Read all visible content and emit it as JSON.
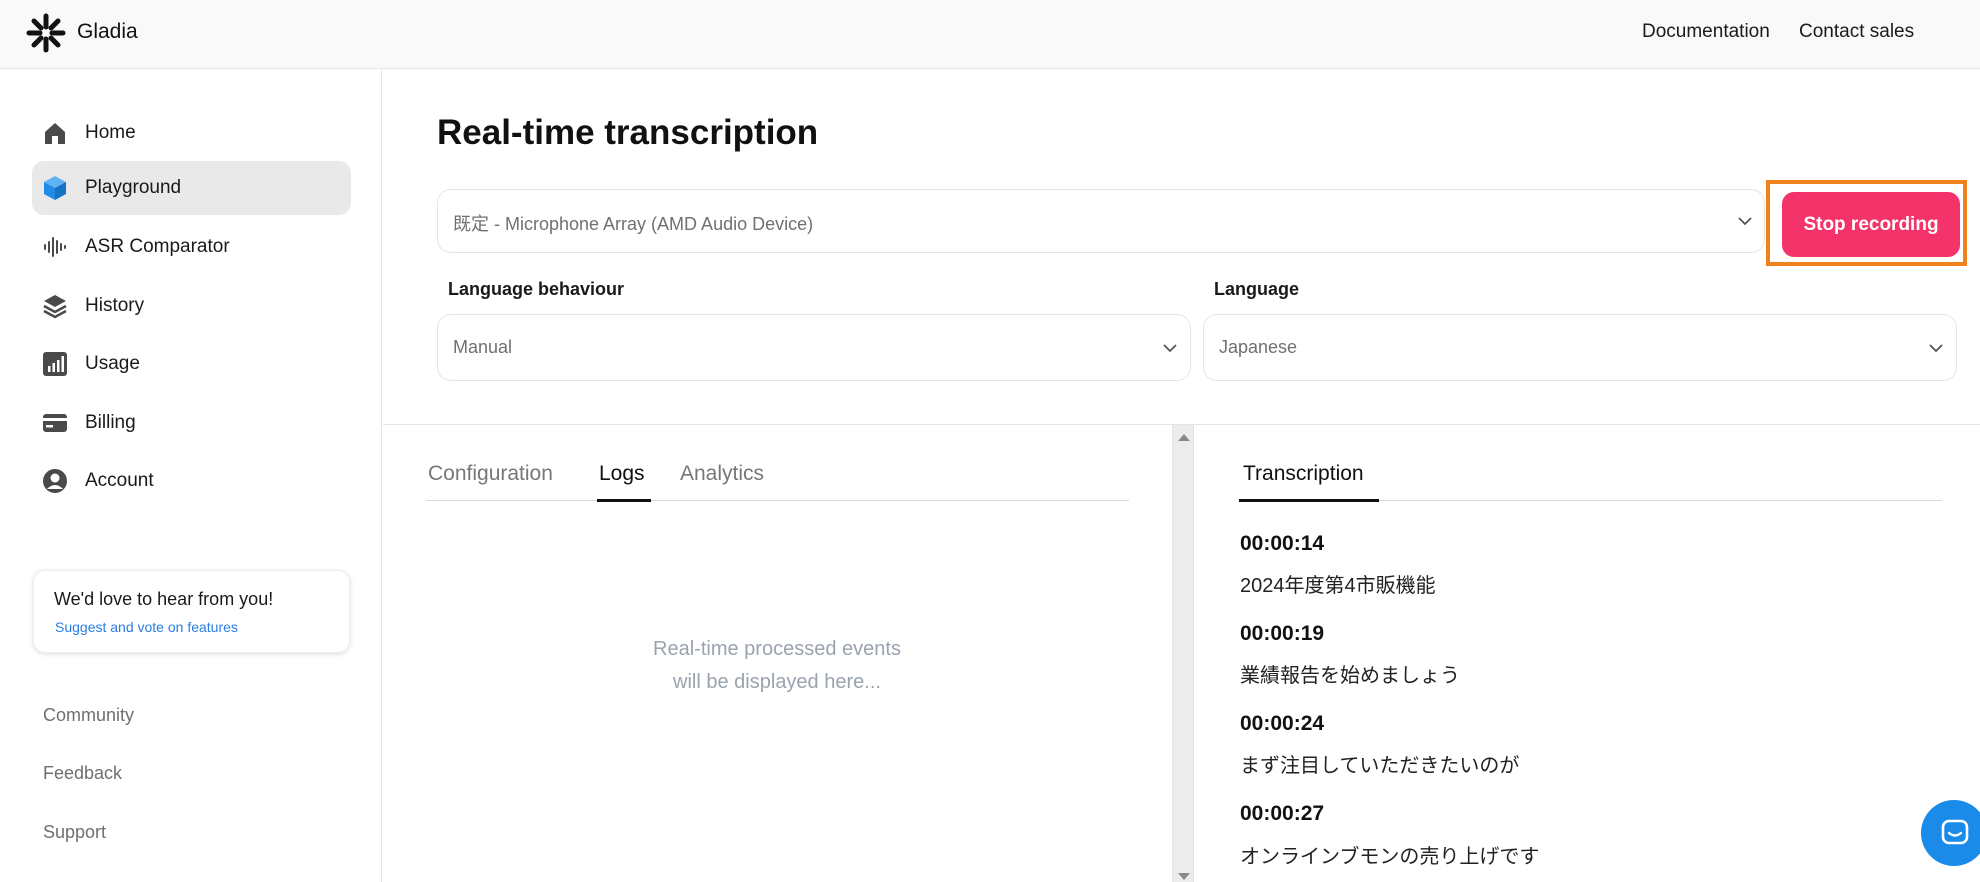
{
  "header": {
    "brand": "Gladia",
    "links": [
      "Documentation",
      "Contact sales"
    ]
  },
  "sidebar": {
    "items": [
      {
        "label": "Home",
        "icon": "home-icon"
      },
      {
        "label": "Playground",
        "icon": "cube-icon"
      },
      {
        "label": "ASR Comparator",
        "icon": "waveform-icon"
      },
      {
        "label": "History",
        "icon": "layers-icon"
      },
      {
        "label": "Usage",
        "icon": "bar-chart-icon"
      },
      {
        "label": "Billing",
        "icon": "credit-card-icon"
      },
      {
        "label": "Account",
        "icon": "user-circle-icon"
      }
    ],
    "active": "Playground",
    "feedback_card": {
      "title": "We'd love to hear from you!",
      "link": "Suggest and vote on features"
    },
    "footer_links": [
      "Community",
      "Feedback",
      "Support"
    ]
  },
  "main": {
    "title": "Real-time transcription",
    "device_select": "既定 - Microphone Array (AMD Audio Device)",
    "stop_button": "Stop recording",
    "language_behaviour": {
      "label": "Language behaviour",
      "value": "Manual"
    },
    "language": {
      "label": "Language",
      "value": "Japanese"
    }
  },
  "left_panel": {
    "tabs": [
      "Configuration",
      "Logs",
      "Analytics"
    ],
    "active_tab": "Logs",
    "empty_message_line1": "Real-time processed events",
    "empty_message_line2": "will be displayed here..."
  },
  "transcription": {
    "tab": "Transcription",
    "entries": [
      {
        "time": "00:00:14",
        "text": "2024年度第4市販機能"
      },
      {
        "time": "00:00:19",
        "text": "業績報告を始めましょう"
      },
      {
        "time": "00:00:24",
        "text": "まず注目していただきたいのが"
      },
      {
        "time": "00:00:27",
        "text": "オンラインブモンの売り上げです"
      }
    ]
  },
  "colors": {
    "accent": "#f5336b",
    "highlight_box": "#f0821e",
    "link": "#2a7de1",
    "playground_icon": "#1e8ce8",
    "chat_button": "#1a8be8"
  }
}
